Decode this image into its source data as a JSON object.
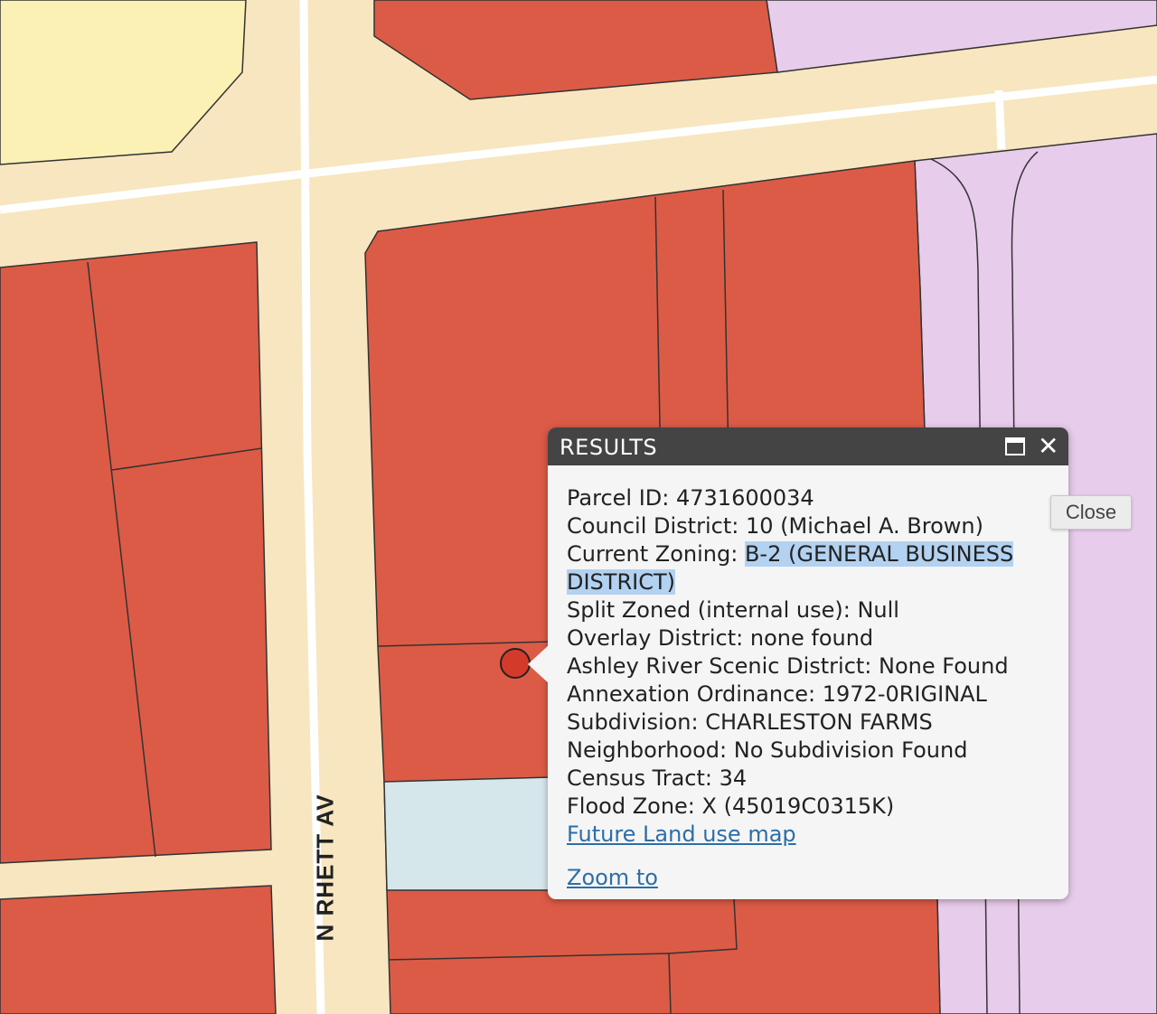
{
  "map": {
    "street_label": "N RHETT AV",
    "colors": {
      "road": "#f7e6bf",
      "business": "#dc5b46",
      "industrial": "#e8ccec",
      "residential": "#fbf1b4",
      "conservation": "#d6e7ec",
      "road_centerline": "#ffffff",
      "parcel_outline": "#333333",
      "marker": "#d43a2a"
    }
  },
  "popup": {
    "title": "RESULTS",
    "rows": [
      {
        "label": "Parcel ID:",
        "value": "4731600034"
      },
      {
        "label": "Council District:",
        "value": "10 (Michael A. Brown)"
      },
      {
        "label": "Current Zoning:",
        "value": "B-2 (GENERAL BUSINESS DISTRICT)"
      },
      {
        "label": "Split Zoned (internal use):",
        "value": "Null"
      },
      {
        "label": "Overlay District:",
        "value": "none found"
      },
      {
        "label": "Ashley River Scenic District:",
        "value": "None Found"
      },
      {
        "label": "Annexation Ordinance:",
        "value": "1972-0RIGINAL"
      },
      {
        "label": "Subdivision:",
        "value": "CHARLESTON FARMS"
      },
      {
        "label": "Neighborhood:",
        "value": "No Subdivision Found"
      },
      {
        "label": "Census Tract:",
        "value": "34"
      },
      {
        "label": "Flood Zone:",
        "value": "X (45019C0315K)"
      }
    ],
    "future_land_use_link": "Future Land use map",
    "zoom_link": "Zoom to"
  },
  "tooltip": {
    "close_label": "Close"
  },
  "icons": {
    "maximize": "maximize-icon",
    "close": "close-icon"
  }
}
